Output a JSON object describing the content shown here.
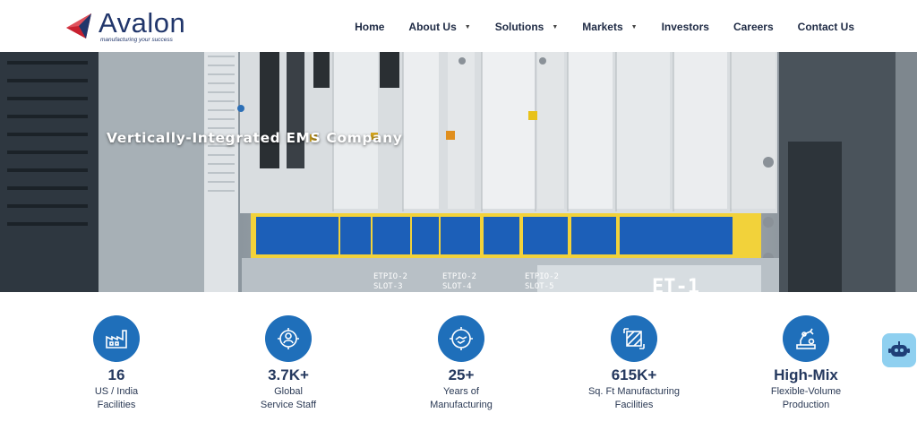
{
  "brand": {
    "name": "Avalon",
    "tagline": "manufacturing your success"
  },
  "nav": {
    "items": [
      {
        "label": "Home",
        "has_dropdown": false
      },
      {
        "label": "About Us",
        "has_dropdown": true
      },
      {
        "label": "Solutions",
        "has_dropdown": true
      },
      {
        "label": "Markets",
        "has_dropdown": true
      },
      {
        "label": "Investors",
        "has_dropdown": false
      },
      {
        "label": "Careers",
        "has_dropdown": false
      },
      {
        "label": "Contact Us",
        "has_dropdown": false
      }
    ],
    "caret": "▼"
  },
  "hero": {
    "title": "Vertically-Integrated EMS Company",
    "panel_labels": [
      "ETPIO-2",
      "SLOT-3",
      "ETPIO-2",
      "SLOT-4",
      "ETPIO-2",
      "SLOT-5",
      "ET-1"
    ]
  },
  "stats": [
    {
      "icon": "factory-icon",
      "value": "16",
      "line1": "US / India",
      "line2": "Facilities"
    },
    {
      "icon": "gear-person-icon",
      "value": "3.7K+",
      "line1": "Global",
      "line2": "Service Staff"
    },
    {
      "icon": "handshake-gear-icon",
      "value": "25+",
      "line1": "Years of",
      "line2": "Manufacturing"
    },
    {
      "icon": "floor-area-icon",
      "value": "615K+",
      "line1": "Sq. Ft Manufacturing",
      "line2": "Facilities"
    },
    {
      "icon": "robot-arm-icon",
      "value": "High-Mix",
      "line1": "Flexible-Volume",
      "line2": "Production"
    }
  ],
  "colors": {
    "brand_navy": "#21366b",
    "brand_red": "#c8202f",
    "icon_blue": "#1f6fba",
    "panel_blue": "#1c5fb8",
    "label_yellow": "#f2d23a"
  },
  "chat": {
    "icon": "chatbot-icon"
  }
}
